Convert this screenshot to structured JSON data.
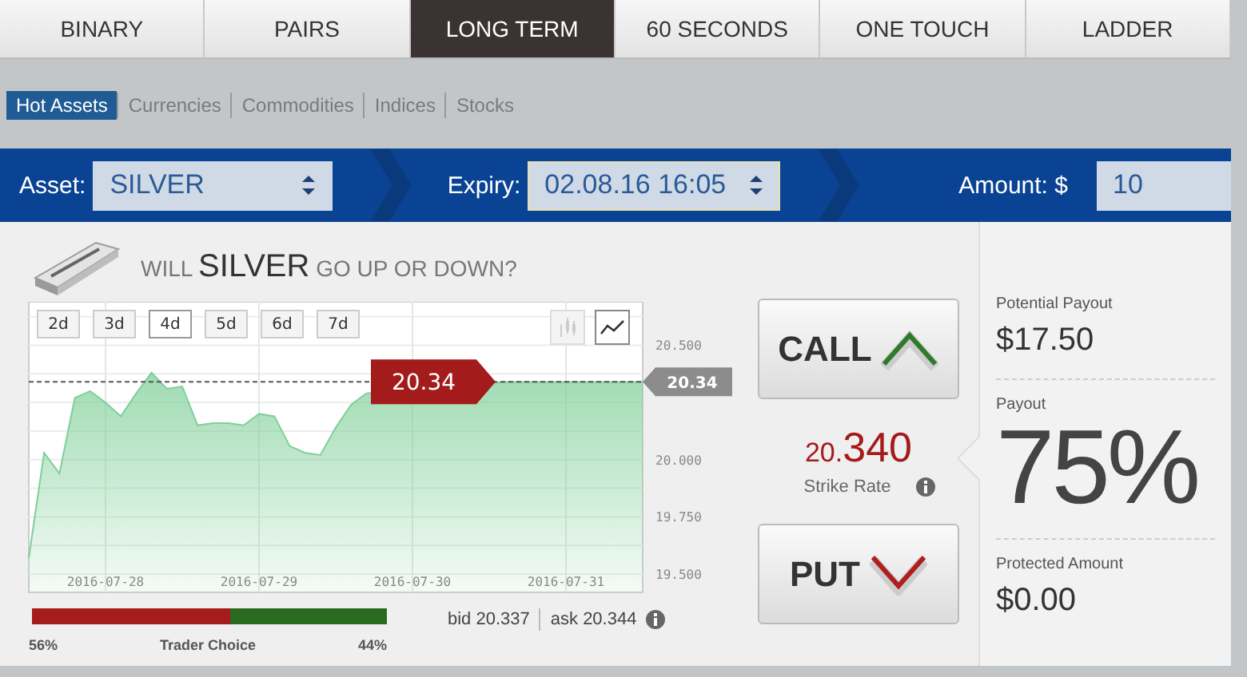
{
  "tabs": [
    {
      "label": "BINARY",
      "selected": false
    },
    {
      "label": "PAIRS",
      "selected": false
    },
    {
      "label": "LONG TERM",
      "selected": true
    },
    {
      "label": "60 SECONDS",
      "selected": false
    },
    {
      "label": "ONE TOUCH",
      "selected": false
    },
    {
      "label": "LADDER",
      "selected": false
    }
  ],
  "subtabs": [
    {
      "label": "Hot Assets",
      "selected": true
    },
    {
      "label": "Currencies",
      "selected": false
    },
    {
      "label": "Commodities",
      "selected": false
    },
    {
      "label": "Indices",
      "selected": false
    },
    {
      "label": "Stocks",
      "selected": false
    }
  ],
  "trade_bar": {
    "asset_label": "Asset:",
    "asset": "SILVER",
    "expiry_label": "Expiry:",
    "expiry": "02.08.16 16:05",
    "amount_label": "Amount: $",
    "amount": "10"
  },
  "question": {
    "prefix": "WILL",
    "asset": "SILVER",
    "suffix": "GO UP OR DOWN?"
  },
  "ranges": [
    {
      "label": "2d",
      "selected": false
    },
    {
      "label": "3d",
      "selected": false
    },
    {
      "label": "4d",
      "selected": true
    },
    {
      "label": "5d",
      "selected": false
    },
    {
      "label": "6d",
      "selected": false
    },
    {
      "label": "7d",
      "selected": false
    }
  ],
  "chart_types": [
    {
      "kind": "candles",
      "selected": false
    },
    {
      "kind": "line",
      "selected": true
    }
  ],
  "chart": {
    "current_flag": "20.34",
    "axis_flag": "20.34",
    "chart_data": {
      "type": "area",
      "categories": [
        null,
        null,
        null,
        null,
        null,
        "2016-07-28",
        null,
        null,
        null,
        null,
        null,
        null,
        null,
        null,
        null,
        "2016-07-29",
        null,
        null,
        null,
        null,
        null,
        null,
        null,
        null,
        null,
        "2016-07-30",
        null,
        null,
        null,
        null,
        null,
        null,
        null,
        null,
        null,
        "2016-07-31",
        null,
        null,
        null,
        null,
        null
      ],
      "series": [
        {
          "color": "#7fcf98",
          "values": [
            19.57,
            20.03,
            19.94,
            20.27,
            20.3,
            20.25,
            20.19,
            20.29,
            20.38,
            20.31,
            20.32,
            20.15,
            20.16,
            20.16,
            20.15,
            20.2,
            20.19,
            20.06,
            20.03,
            20.02,
            20.14,
            20.24,
            20.29,
            null,
            null,
            null,
            null,
            null,
            null,
            null,
            null,
            20.34,
            20.34,
            20.34,
            20.34,
            20.34,
            20.34,
            20.34,
            20.34,
            20.34,
            20.34
          ]
        }
      ],
      "ylim": [
        19.42,
        20.69
      ],
      "grid": true,
      "ref_lines": [
        {
          "axis": "y",
          "value": 20.34
        }
      ],
      "yticks": [
        {
          "value": 20.5,
          "label": "20.500"
        },
        {
          "value": 20,
          "label": "20.000"
        },
        {
          "value": 19.75,
          "label": "19.750"
        },
        {
          "value": 19.5,
          "label": "19.500"
        }
      ]
    }
  },
  "trader_choice": {
    "label": "Trader Choice",
    "put_share": "56%",
    "call_share": "44%",
    "level": 0.56
  },
  "quote": {
    "bid": "bid 20.337",
    "ask": "ask 20.344"
  },
  "call_button": "CALL",
  "put_button": "PUT",
  "strike": {
    "value": "20.340",
    "label": "Strike Rate"
  },
  "payout": {
    "potential_label": "Potential Payout",
    "potential": "$17.50",
    "payout_label": "Payout",
    "payout": "75%",
    "protected_label": "Protected Amount",
    "protected": "$0.00"
  }
}
